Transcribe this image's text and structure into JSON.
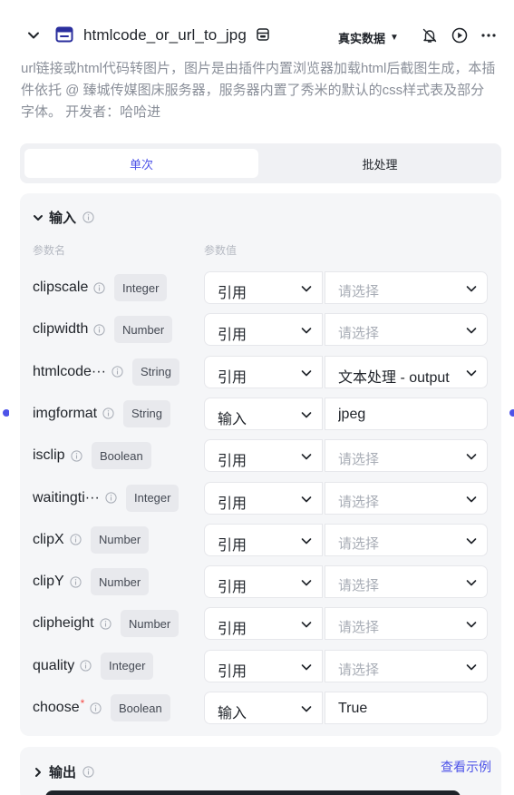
{
  "header": {
    "title": "htmlcode_or_url_to_jpg",
    "data_mode": "真实数据",
    "data_mode_caret": "▼"
  },
  "description": "url链接或html代码转图片，图片是由插件内置浏览器加载html后截图生成，本插件依托 @ 臻城传媒图床服务器，服务器内置了秀米的默认的css样式表及部分字体。 开发者：哈哈进",
  "tabs": [
    {
      "label": "单次",
      "active": true
    },
    {
      "label": "批处理",
      "active": false
    }
  ],
  "input_section": {
    "title": "输入",
    "col_name": "参数名",
    "col_value": "参数值",
    "params": [
      {
        "name": "clipscale",
        "type": "Integer",
        "mode": "引用",
        "value": "请选择",
        "placeholder": true,
        "required": false
      },
      {
        "name": "clipwidth",
        "type": "Number",
        "mode": "引用",
        "value": "请选择",
        "placeholder": true,
        "required": false
      },
      {
        "name": "htmlcode···",
        "type": "String",
        "mode": "引用",
        "value": "文本处理 - output",
        "placeholder": false,
        "required": false
      },
      {
        "name": "imgformat",
        "type": "String",
        "mode": "输入",
        "value": "jpeg",
        "placeholder": false,
        "required": false
      },
      {
        "name": "isclip",
        "type": "Boolean",
        "mode": "引用",
        "value": "请选择",
        "placeholder": true,
        "required": false
      },
      {
        "name": "waitingti···",
        "type": "Integer",
        "mode": "引用",
        "value": "请选择",
        "placeholder": true,
        "required": false
      },
      {
        "name": "clipX",
        "type": "Number",
        "mode": "引用",
        "value": "请选择",
        "placeholder": true,
        "required": false
      },
      {
        "name": "clipY",
        "type": "Number",
        "mode": "引用",
        "value": "请选择",
        "placeholder": true,
        "required": false
      },
      {
        "name": "clipheight",
        "type": "Number",
        "mode": "引用",
        "value": "请选择",
        "placeholder": true,
        "required": false
      },
      {
        "name": "quality",
        "type": "Integer",
        "mode": "引用",
        "value": "请选择",
        "placeholder": true,
        "required": false
      },
      {
        "name": "choose",
        "type": "Boolean",
        "mode": "输入",
        "value": "True",
        "placeholder": false,
        "required": true
      }
    ]
  },
  "output_section": {
    "title": "输出",
    "example_link": "查看示例"
  },
  "required_mark": "*",
  "colors": {
    "accent": "#4d53e8",
    "required": "#f54a45"
  }
}
